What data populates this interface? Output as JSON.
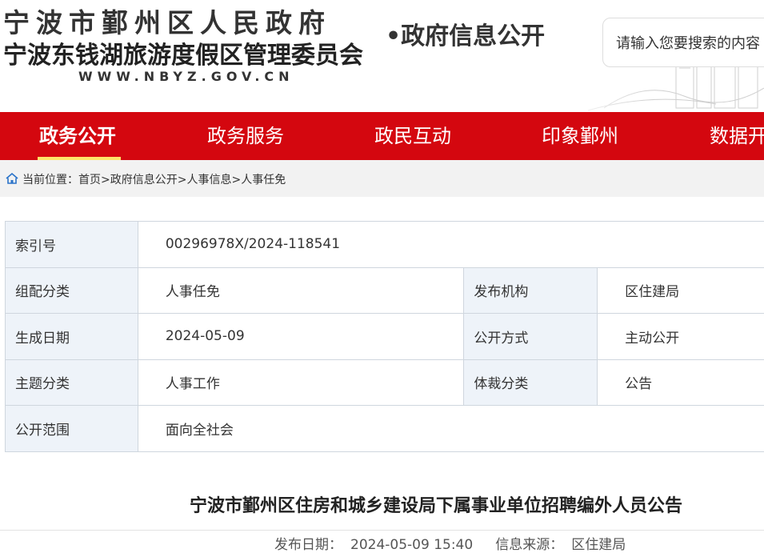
{
  "header": {
    "site_name_1": "宁波市鄞州区人民政府",
    "site_name_2": "宁波东钱湖旅游度假区管理委员会",
    "site_url": "WWW.NBYZ.GOV.CN",
    "section_title": "•政府信息公开",
    "search_placeholder": "请输入您要搜索的内容"
  },
  "nav": {
    "items": [
      {
        "label": "政务公开",
        "active": true
      },
      {
        "label": "政务服务",
        "active": false
      },
      {
        "label": "政民互动",
        "active": false
      },
      {
        "label": "印象鄞州",
        "active": false
      },
      {
        "label": "数据开放",
        "active": false
      }
    ],
    "accent_color": "#d4070f",
    "underline_color": "#ffe36a"
  },
  "breadcrumb": {
    "prefix": "当前位置：",
    "items": [
      "首页",
      "政府信息公开",
      "人事信息",
      "人事任免"
    ],
    "separator": ">"
  },
  "info_table": {
    "index_label": "索引号",
    "index_value": "00296978X/2024-118541",
    "category_label": "组配分类",
    "category_value": "人事任免",
    "publisher_label": "发布机构",
    "publisher_value": "区住建局",
    "date_label": "生成日期",
    "date_value": "2024-05-09",
    "open_mode_label": "公开方式",
    "open_mode_value": "主动公开",
    "topic_label": "主题分类",
    "topic_value": "人事工作",
    "genre_label": "体裁分类",
    "genre_value": "公告",
    "scope_label": "公开范围",
    "scope_value": "面向全社会"
  },
  "article": {
    "title": "宁波市鄞州区住房和城乡建设局下属事业单位招聘编外人员公告",
    "publish_label": "发布日期：",
    "publish_value": "2024-05-09 15:40",
    "source_label": "信息来源：",
    "source_value": "区住建局"
  }
}
